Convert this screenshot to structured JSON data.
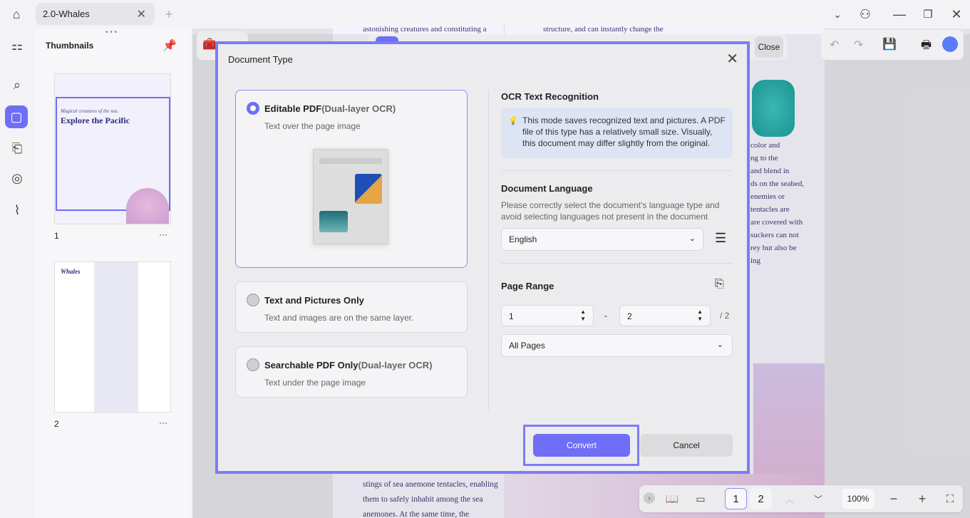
{
  "tabbar": {
    "tab_title": "2.0-Whales"
  },
  "thumbnails": {
    "title": "Thumbnails",
    "pages": [
      {
        "number": "1",
        "heading": "Explore the Pacific",
        "subheading": "Magical creatures of the sea."
      },
      {
        "number": "2",
        "heading": "Whales"
      }
    ]
  },
  "document": {
    "top_left_text": "astonishing creatures and constituting a",
    "top_mid_text": "structure, and can instantly change the",
    "right_lines": [
      "color and",
      "ng to the",
      "and blend in",
      "ds on the seabed,",
      "enemies or",
      "tentacles are",
      "are covered with",
      "suckers can not",
      "rey but also be",
      "ing"
    ],
    "bottom_lines": [
      "stings of sea anemone tentacles, enabling",
      "them to safely inhabit among the sea",
      "anemones. At the same time, the"
    ]
  },
  "toolbar": {
    "close_label": "Close"
  },
  "dialog": {
    "title": "Document Type",
    "options": [
      {
        "title": "Editable PDF",
        "title_suffix": "(Dual-layer OCR)",
        "subtitle": "Text over the page image",
        "selected": true
      },
      {
        "title": "Text and Pictures Only",
        "title_suffix": "",
        "subtitle": "Text and images are on the same layer.",
        "selected": false
      },
      {
        "title": "Searchable PDF Only",
        "title_suffix": "(Dual-layer OCR)",
        "subtitle": "Text under the page image",
        "selected": false
      }
    ],
    "ocr_title": "OCR Text Recognition",
    "ocr_info": "This mode saves recognized text and pictures. A PDF file of this type has a relatively small size. Visually, this document may differ slightly from the original.",
    "lang_title": "Document Language",
    "lang_desc": "Please correctly select the document's language type and avoid selecting languages not present in the document",
    "language": "English",
    "range_title": "Page Range",
    "range_from": "1",
    "range_to": "2",
    "range_sep": "-",
    "range_total": "/ 2",
    "range_select": "All Pages",
    "convert_label": "Convert",
    "cancel_label": "Cancel"
  },
  "bottombar": {
    "page1": "1",
    "page2": "2",
    "zoom": "100%"
  },
  "colors": {
    "accent": "#6e6ef6",
    "highlight": "#7c7cf6"
  }
}
